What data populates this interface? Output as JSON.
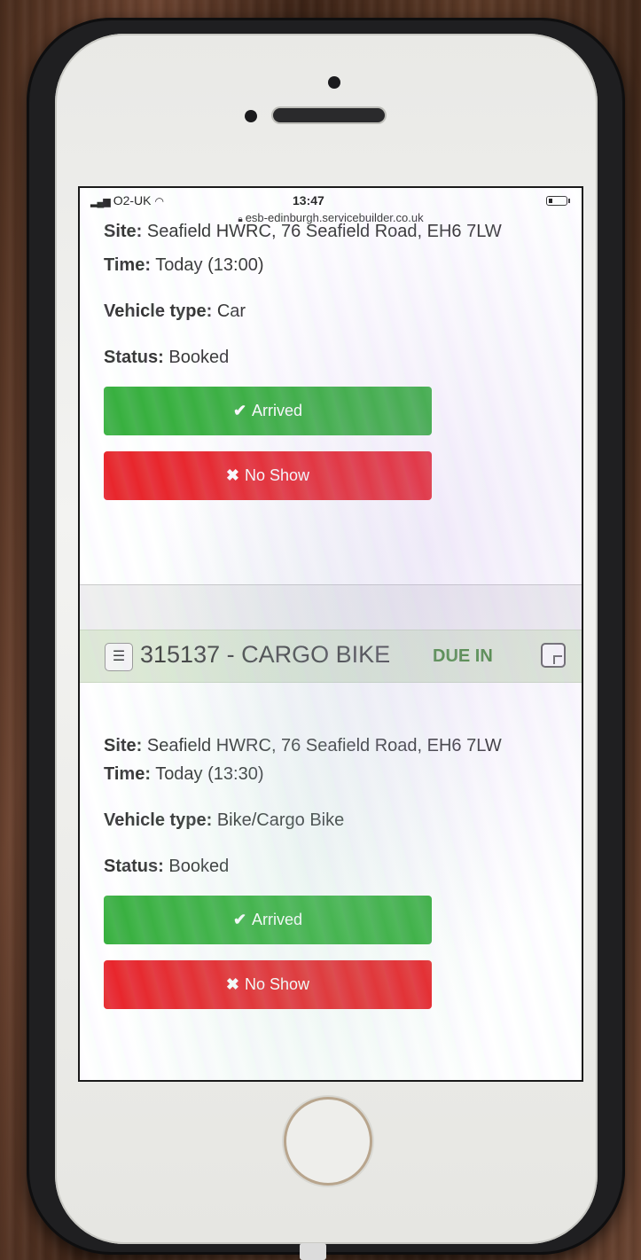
{
  "status_bar": {
    "carrier": "O2-UK",
    "time": "13:47",
    "url": "esb-edinburgh.servicebuilder.co.uk"
  },
  "bookings": [
    {
      "ref": "",
      "due": "",
      "site_label": "Site:",
      "site_value": "Seafield HWRC, 76 Seafield Road, EH6 7LW",
      "time_label": "Time:",
      "time_value": "Today (13:00)",
      "vehicle_label": "Vehicle type:",
      "vehicle_value": "Car",
      "status_label": "Status:",
      "status_value": "Booked"
    },
    {
      "ref": "315137 - CARGO BIKE",
      "due": "DUE IN",
      "site_label": "Site:",
      "site_value": "Seafield HWRC, 76 Seafield Road, EH6 7LW",
      "time_label": "Time:",
      "time_value": "Today (13:30)",
      "vehicle_label": "Vehicle type:",
      "vehicle_value": "Bike/Cargo Bike",
      "status_label": "Status:",
      "status_value": "Booked"
    }
  ],
  "buttons": {
    "arrived_icon": "✔",
    "arrived_label": "Arrived",
    "noshow_icon": "✖",
    "noshow_label": "No Show"
  },
  "icons": {
    "details": "list-icon",
    "note": "note-icon",
    "signal": "signal-icon",
    "wifi": "wifi-icon",
    "battery": "battery-icon",
    "lock": "lock-icon"
  },
  "colors": {
    "arrived": "#38b03f",
    "noshow": "#e8262c",
    "header_band": "#dde8d5",
    "due_text": "#4a8a3d"
  }
}
